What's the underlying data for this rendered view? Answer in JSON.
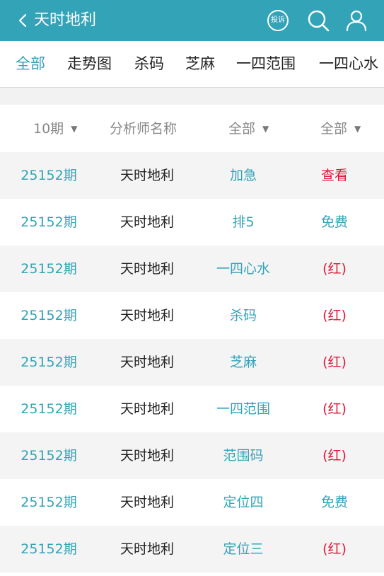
{
  "header": {
    "title": "天时地利",
    "complain_label": "投诉"
  },
  "tabs": [
    {
      "label": "全部",
      "active": true
    },
    {
      "label": "走势图"
    },
    {
      "label": "杀码"
    },
    {
      "label": "芝麻"
    },
    {
      "label": "一四范围"
    },
    {
      "label": "一四心水"
    }
  ],
  "filters": {
    "period": "10期",
    "analyst": "分析师名称",
    "category": "全部",
    "status": "全部"
  },
  "rows": [
    {
      "period": "25152期",
      "analyst": "天时地利",
      "type": "加急",
      "action": "查看",
      "action_color": "red"
    },
    {
      "period": "25152期",
      "analyst": "天时地利",
      "type": "排5",
      "action": "免费",
      "action_color": "teal"
    },
    {
      "period": "25152期",
      "analyst": "天时地利",
      "type": "一四心水",
      "action": "(红)",
      "action_color": "red"
    },
    {
      "period": "25152期",
      "analyst": "天时地利",
      "type": "杀码",
      "action": "(红)",
      "action_color": "red"
    },
    {
      "period": "25152期",
      "analyst": "天时地利",
      "type": "芝麻",
      "action": "(红)",
      "action_color": "red"
    },
    {
      "period": "25152期",
      "analyst": "天时地利",
      "type": "一四范围",
      "action": "(红)",
      "action_color": "red"
    },
    {
      "period": "25152期",
      "analyst": "天时地利",
      "type": "范围码",
      "action": "(红)",
      "action_color": "red"
    },
    {
      "period": "25152期",
      "analyst": "天时地利",
      "type": "定位四",
      "action": "免费",
      "action_color": "teal"
    },
    {
      "period": "25152期",
      "analyst": "天时地利",
      "type": "定位三",
      "action": "(红)",
      "action_color": "red"
    }
  ],
  "colors": {
    "accent": "#33a3b8",
    "red": "#e0173a",
    "row_alt": "#f4f4f4"
  }
}
